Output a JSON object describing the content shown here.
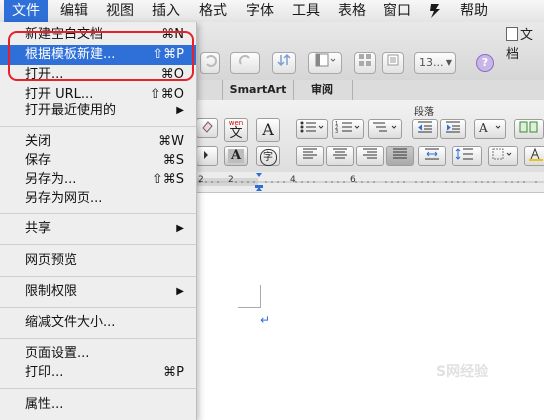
{
  "menubar": {
    "items": [
      {
        "label": "文件"
      },
      {
        "label": "编辑"
      },
      {
        "label": "视图"
      },
      {
        "label": "插入"
      },
      {
        "label": "格式"
      },
      {
        "label": "字体"
      },
      {
        "label": "工具"
      },
      {
        "label": "表格"
      },
      {
        "label": "窗口"
      },
      {
        "label": "帮助"
      }
    ],
    "script_icon": "scroll-icon"
  },
  "window": {
    "title": "文档"
  },
  "toolbar": {
    "zoom_value": "13..."
  },
  "ribbon": {
    "tabs": [
      "SmartArt",
      "审阅"
    ],
    "group_label": "段落",
    "phonetic_label": "wen",
    "phonetic_char": "文",
    "char_A": "A",
    "char_enclosed": "字"
  },
  "ruler": {
    "marks": [
      "2",
      "2",
      "4",
      "6"
    ]
  },
  "file_menu": {
    "items": [
      {
        "label": "新建空白文档",
        "shortcut": "⌘N"
      },
      {
        "label": "根据模板新建...",
        "shortcut": "⇧⌘P"
      },
      {
        "label": "打开...",
        "shortcut": "⌘O"
      },
      {
        "label": "打开 URL...",
        "shortcut": "⇧⌘O"
      },
      {
        "label": "打开最近使用的",
        "shortcut": ""
      },
      {
        "label": "关闭",
        "shortcut": "⌘W"
      },
      {
        "label": "保存",
        "shortcut": "⌘S"
      },
      {
        "label": "另存为...",
        "shortcut": "⇧⌘S"
      },
      {
        "label": "另存为网页...",
        "shortcut": ""
      },
      {
        "label": "共享",
        "shortcut": ""
      },
      {
        "label": "网页预览",
        "shortcut": ""
      },
      {
        "label": "限制权限",
        "shortcut": ""
      },
      {
        "label": "缩减文件大小...",
        "shortcut": ""
      },
      {
        "label": "页面设置...",
        "shortcut": ""
      },
      {
        "label": "打印...",
        "shortcut": "⌘P"
      },
      {
        "label": "属性...",
        "shortcut": ""
      }
    ],
    "highlighted_index": 1
  },
  "watermark": "S网经验",
  "colors": {
    "highlight": "#2f6fd8",
    "annotation": "#e8202a"
  }
}
